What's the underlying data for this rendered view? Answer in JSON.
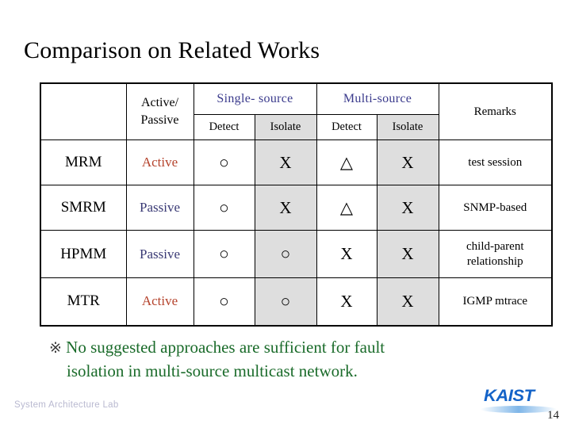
{
  "slide": {
    "title": "Comparison on Related Works",
    "page_number": "14"
  },
  "table": {
    "header": {
      "corner_blank": "",
      "active_passive_line1": "Active/",
      "active_passive_line2": "Passive",
      "group_single": "Single- source",
      "group_multi": "Multi-source",
      "remarks": "Remarks",
      "sub_single_detect": "Detect",
      "sub_single_isolate": "Isolate",
      "sub_multi_detect": "Detect",
      "sub_multi_isolate": "Isolate"
    },
    "rows": [
      {
        "method": "MRM",
        "active_passive": "Active",
        "ap_kind": "active",
        "single_detect": "○",
        "single_isolate": "X",
        "multi_detect": "△",
        "multi_isolate": "X",
        "remarks_line1": "test session",
        "remarks_line2": ""
      },
      {
        "method": "SMRM",
        "active_passive": "Passive",
        "ap_kind": "passive",
        "single_detect": "○",
        "single_isolate": "X",
        "multi_detect": "△",
        "multi_isolate": "X",
        "remarks_line1": "SNMP-based",
        "remarks_line2": ""
      },
      {
        "method": "HPMM",
        "active_passive": "Passive",
        "ap_kind": "passive",
        "single_detect": "○",
        "single_isolate": "○",
        "multi_detect": "X",
        "multi_isolate": "X",
        "remarks_line1": "child-parent",
        "remarks_line2": "relationship"
      },
      {
        "method": "MTR",
        "active_passive": "Active",
        "ap_kind": "active",
        "single_detect": "○",
        "single_isolate": "○",
        "multi_detect": "X",
        "multi_isolate": "X",
        "remarks_line1": "IGMP mtrace",
        "remarks_line2": ""
      }
    ]
  },
  "note": {
    "mark": "※",
    "line1": "No suggested approaches are sufficient for fault",
    "line2": "isolation in multi-source multicast network."
  },
  "footer": {
    "lab": "System Architecture Lab",
    "logo_text": "KAIST"
  },
  "colors": {
    "group_header": "#3a3a8c",
    "active": "#b5432c",
    "passive": "#3a3a75",
    "note_green": "#1a6b2a",
    "shade": "#dedede",
    "logo_blue": "#1463c8",
    "lab_text": "#b9b9d0"
  }
}
